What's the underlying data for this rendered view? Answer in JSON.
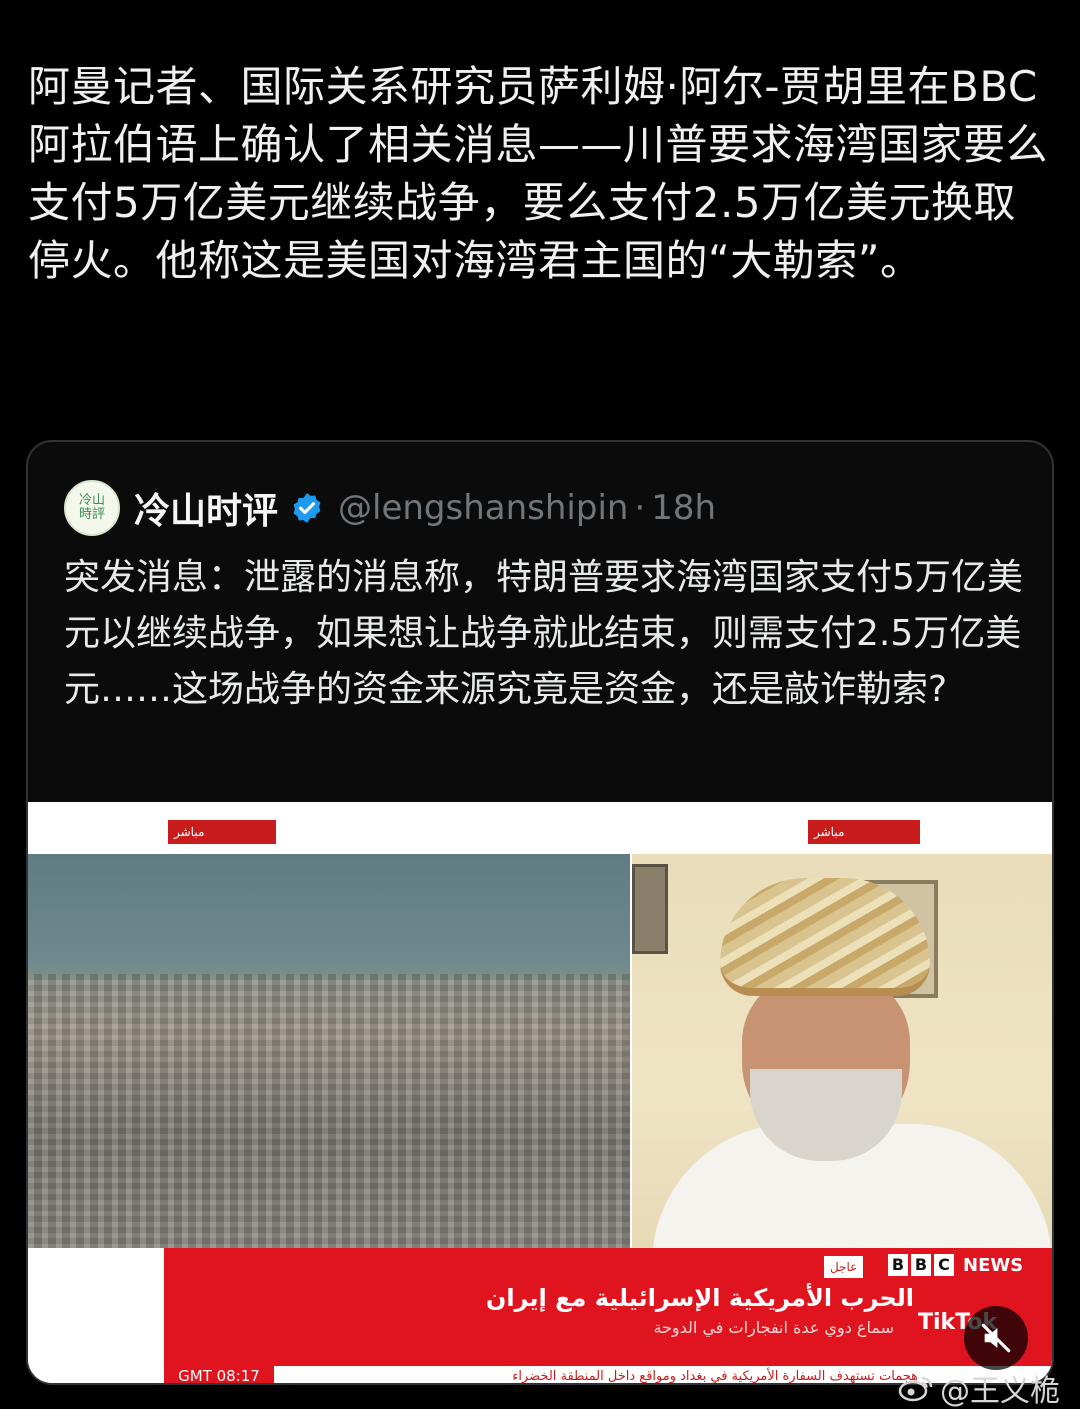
{
  "post": {
    "text": "阿曼记者、国际关系研究员萨利姆·阿尔-贾胡里在BBC阿拉伯语上确认了相关消息——川普要求海湾国家要么支付5万亿美元继续战争，要么支付2.5万亿美元换取停火。他称这是美国对海湾君主国的“大勒索”。"
  },
  "quoted": {
    "avatar_text": "冷山時評",
    "author": "冷山时评",
    "handle": "@lengshanshipin",
    "separator": "·",
    "time": "18h",
    "text": "突发消息：泄露的消息称，特朗普要求海湾国家支付5万亿美元以继续战争，如果想让战争就此结束，则需支付2.5万亿美元……这场战争的资金来源究竟是资金，还是敲诈勒索?",
    "verified_color": "#1d9bf0",
    "media": {
      "live_tag_left": "مباشر",
      "live_tag_right": "مباشر",
      "live_box": "عاجل",
      "bbc": [
        "B",
        "B",
        "C"
      ],
      "news_word": "NEWS",
      "headline": "الحرب الأمريكية الإسرائيلية مع إيران",
      "subline": "سماع دوي عدة انفجارات في الدوحة",
      "gmt": "GMT 08:17",
      "ticker": "هجمات تستهدف السفارة الأمريكية في بغداد ومواقع داخل المنطقة الخضراء",
      "tiktok": "TikTok",
      "mute_icon": "speaker-muted-icon"
    }
  },
  "watermark": {
    "text": "@王义桅",
    "logo_icon": "weibo-logo-icon"
  }
}
